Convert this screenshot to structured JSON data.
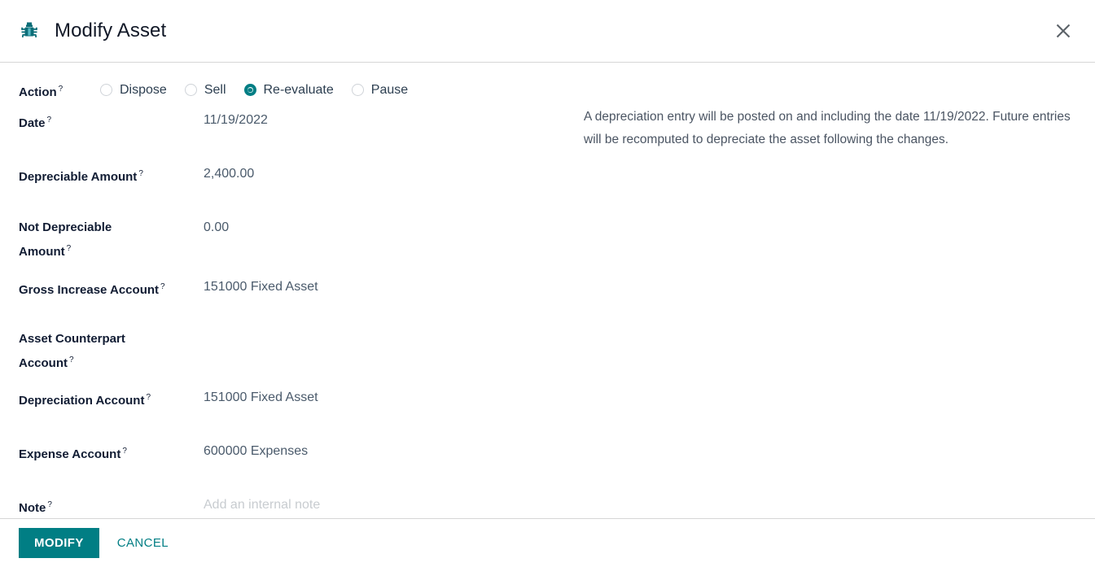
{
  "header": {
    "title": "Modify Asset",
    "icon": "bug-icon",
    "close_icon": "close-icon"
  },
  "colors": {
    "accent": "#017e84",
    "label": "#111c33",
    "value": "#4a5a6b",
    "placeholder": "#c8ccd0",
    "divider": "#d6d6d6"
  },
  "form": {
    "action": {
      "label": "Action",
      "help_marker": "?",
      "options": [
        {
          "label": "Dispose",
          "selected": false
        },
        {
          "label": "Sell",
          "selected": false
        },
        {
          "label": "Re-evaluate",
          "selected": true
        },
        {
          "label": "Pause",
          "selected": false
        }
      ]
    },
    "fields": [
      {
        "label": "Date",
        "value": "11/19/2022",
        "placeholder": false
      },
      {
        "label": "Depreciable Amount",
        "value": "2,400.00",
        "placeholder": false
      },
      {
        "label": "Not Depreciable Amount",
        "value": "0.00",
        "placeholder": false
      },
      {
        "label": "Gross Increase Account",
        "value": "151000 Fixed Asset",
        "placeholder": false
      },
      {
        "label": "Asset Counterpart Account",
        "value": "",
        "placeholder": false
      },
      {
        "label": "Depreciation Account",
        "value": "151000 Fixed Asset",
        "placeholder": false
      },
      {
        "label": "Expense Account",
        "value": "600000 Expenses",
        "placeholder": false
      },
      {
        "label": "Note",
        "value": "Add an internal note",
        "placeholder": true
      }
    ],
    "help_marker": "?",
    "label_parts": {
      "not_depreciable_line1": "Not Depreciable",
      "not_depreciable_line2": "Amount",
      "counterpart_line1": "Asset Counterpart",
      "counterpart_line2": "Account"
    }
  },
  "info": {
    "text": "A depreciation entry will be posted on and including the date 11/19/2022. Future entries will be recomputed to depreciate the asset following the changes."
  },
  "footer": {
    "primary_label": "MODIFY",
    "cancel_label": "CANCEL"
  }
}
